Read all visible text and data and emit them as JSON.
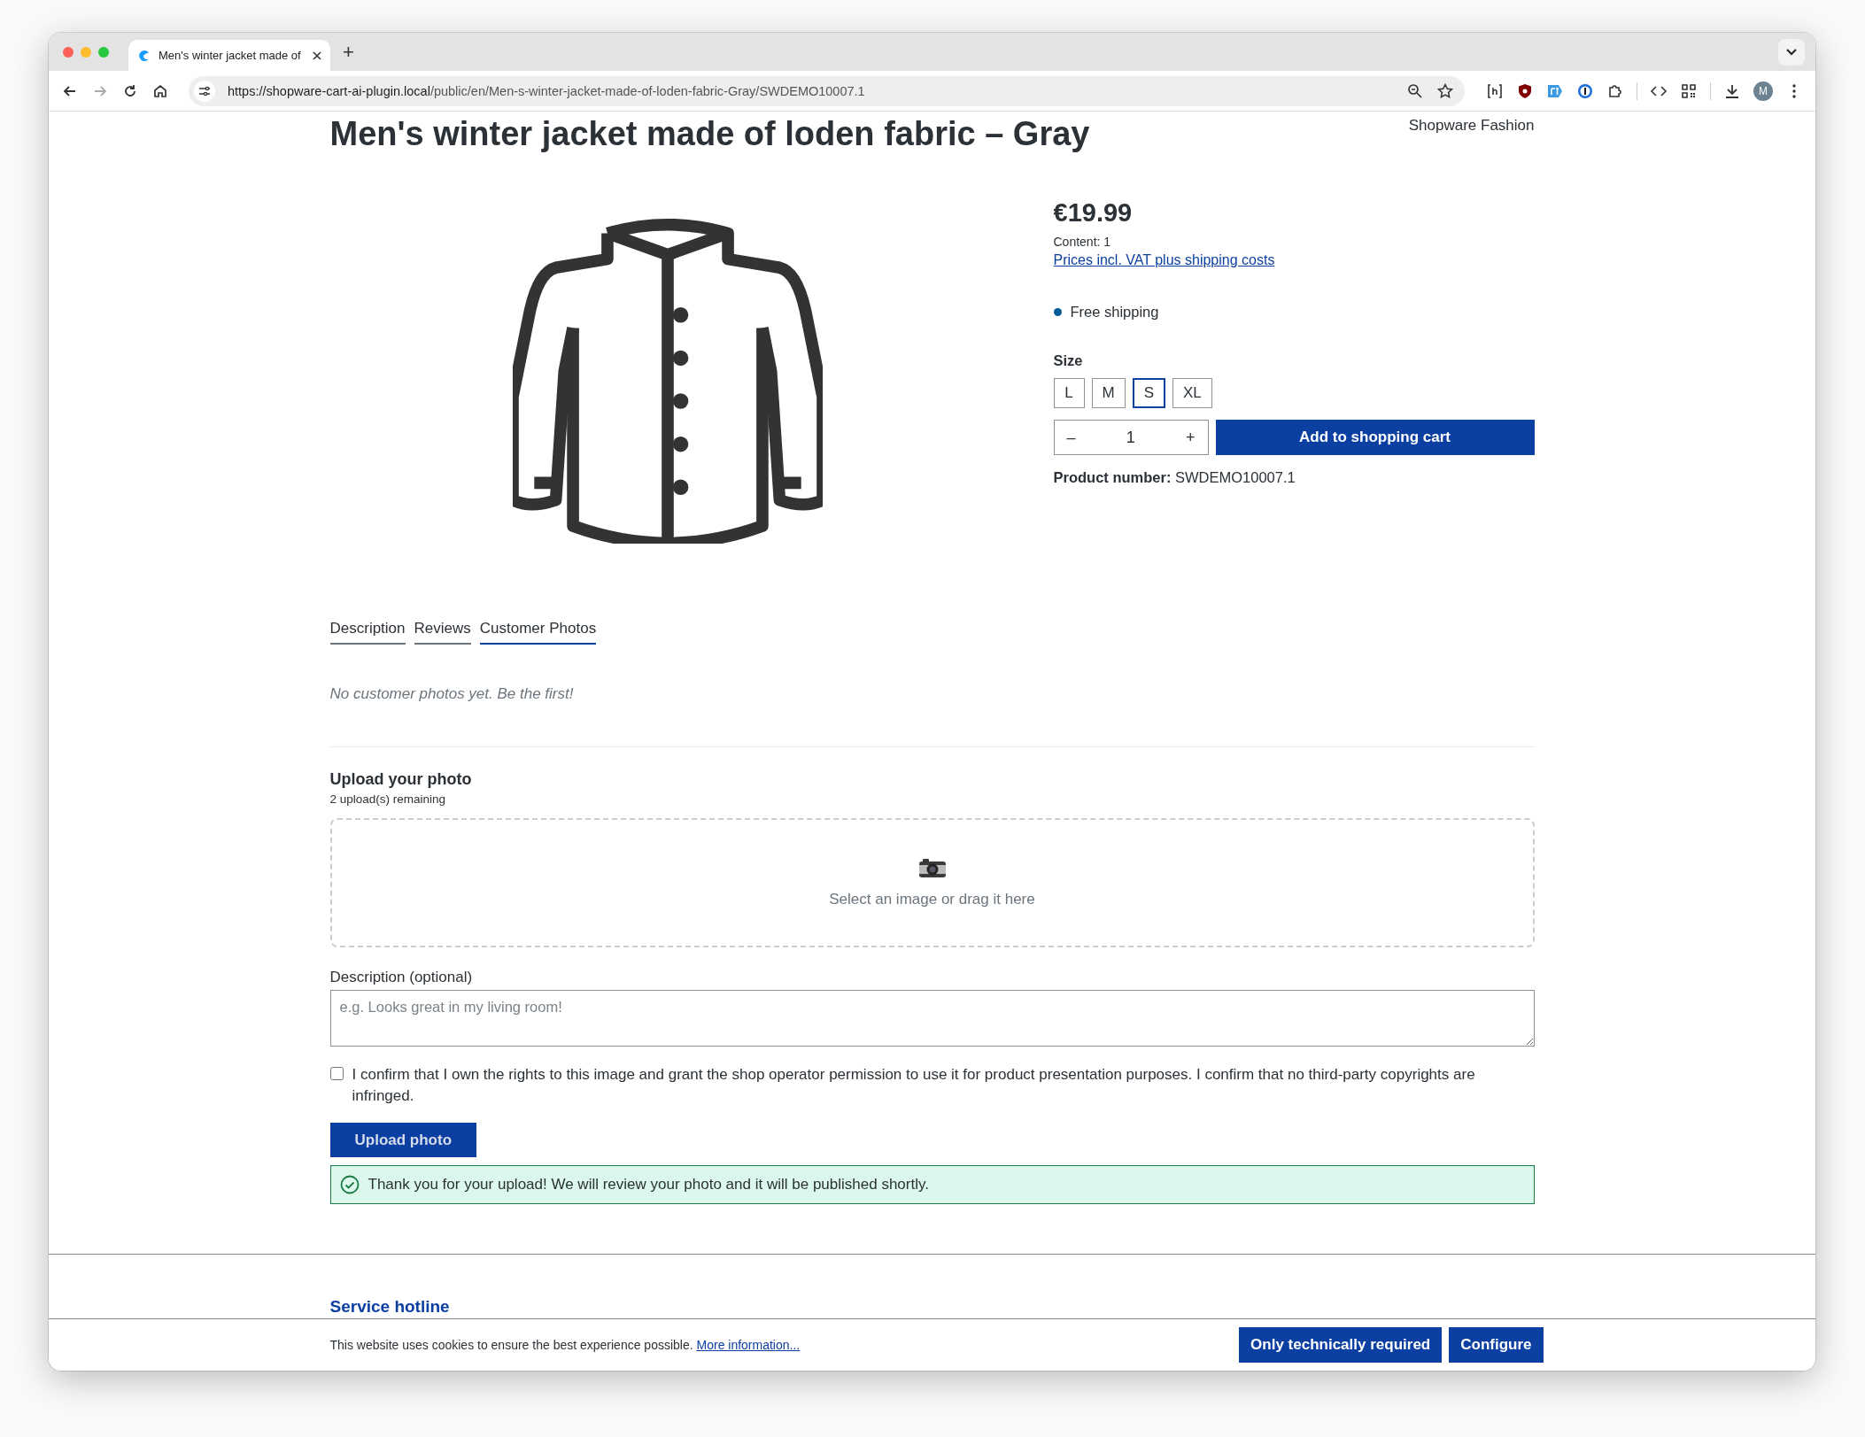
{
  "browser": {
    "tab_title": "Men's winter jacket made of",
    "new_tab": "+",
    "url_host": "https://shopware-cart-ai-plugin.local",
    "url_path": "/public/en/Men-s-winter-jacket-made-of-loden-fabric-Gray/SWDEMO10007.1",
    "profile_initial": "M"
  },
  "product": {
    "title": "Men's winter jacket made of loden fabric – Gray",
    "manufacturer": "Shopware Fashion",
    "price": "€19.99",
    "content": "Content: 1",
    "tax_link": "Prices incl. VAT plus shipping costs",
    "delivery": {
      "text": "Free shipping",
      "color": "#005b99"
    },
    "size_label": "Size",
    "sizes": [
      {
        "label": "L",
        "selected": false
      },
      {
        "label": "M",
        "selected": false
      },
      {
        "label": "S",
        "selected": true
      },
      {
        "label": "XL",
        "selected": false
      }
    ],
    "decrease": "–",
    "quantity": "1",
    "increase": "+",
    "add_to_cart": "Add to shopping cart",
    "product_number_label": "Product number:",
    "product_number": "SWDEMO10007.1"
  },
  "tabs": [
    {
      "label": "Description",
      "selected": false
    },
    {
      "label": "Reviews",
      "selected": false
    },
    {
      "label": "Customer Photos",
      "selected": true
    }
  ],
  "empty_text": "No customer photos yet. Be the first!",
  "upload": {
    "heading": "Upload your photo",
    "remaining": "2 upload(s) remaining",
    "dropzone_text": "Select an image or drag it here",
    "description_label": "Description (optional)",
    "description_placeholder": "e.g. Looks great in my living room!",
    "consent": {
      "text": "I confirm that I own the rights to this image and grant the shop operator permission to use it for product presentation purposes. I confirm that no third-party copyrights are infringed.",
      "checked": false
    },
    "button": "Upload photo",
    "success": "Thank you for your upload! We will review your photo and it will be published shortly."
  },
  "footer": {
    "heading": "Service hotline"
  },
  "cookie_bar": {
    "text": "This website uses cookies to ensure the best experience possible.",
    "link": "More information...",
    "buttons": [
      "Only technically required",
      "Configure"
    ]
  }
}
